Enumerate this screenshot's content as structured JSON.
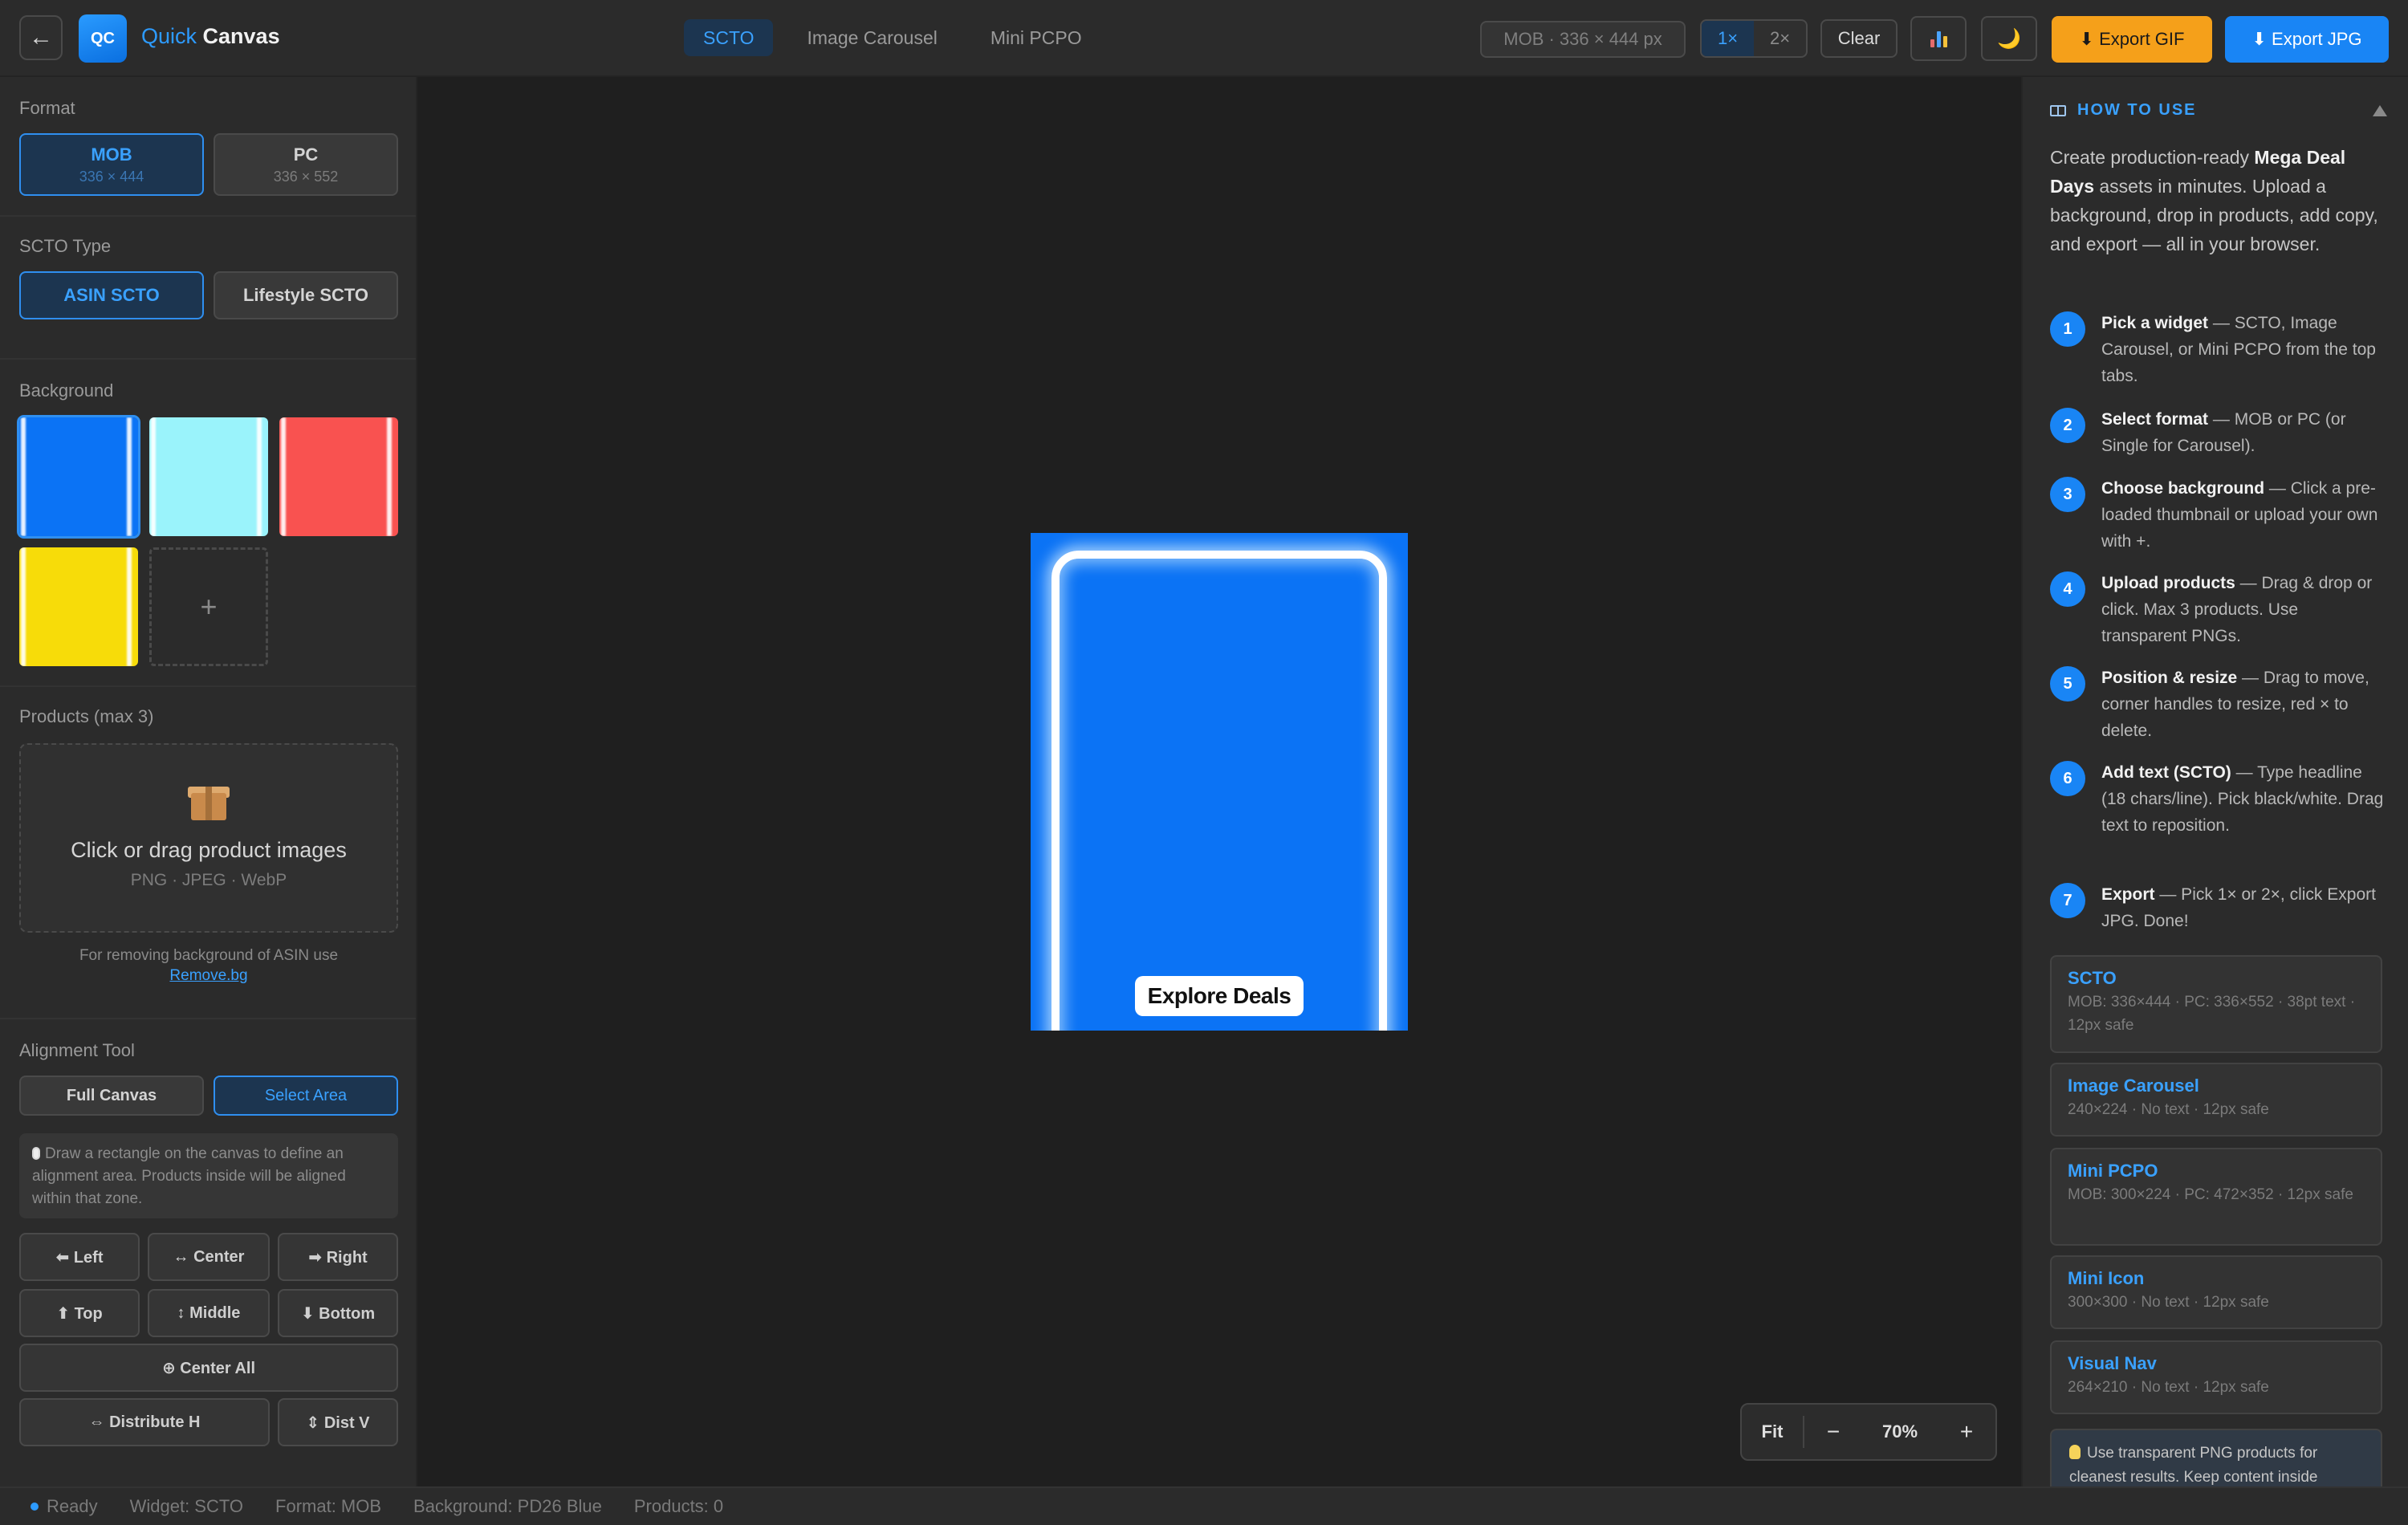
{
  "app": {
    "logo_text": "QC",
    "title_first": "Quick",
    "title_second": " Canvas"
  },
  "header": {
    "back_icon": "←",
    "tabs": [
      {
        "label": "SCTO",
        "active": true
      },
      {
        "label": "Image Carousel",
        "active": false
      },
      {
        "label": "Mini PCPO",
        "active": false
      }
    ],
    "size_readout": "MOB · 336 × 444 px",
    "scale_options": [
      {
        "label": "1×",
        "active": true
      },
      {
        "label": "2×",
        "active": false
      }
    ],
    "clear_label": "Clear",
    "stats_icon": "bar-chart-icon",
    "theme_icon": "🌙",
    "export_gif_label": "⬇ Export GIF",
    "export_jpg_label": "⬇ Export JPG",
    "colors": {
      "accent": "#1985f5",
      "gif": "#f5a01a"
    }
  },
  "sidebar": {
    "format": {
      "label": "Format",
      "options": [
        {
          "title": "MOB",
          "size": "336 × 444",
          "active": true
        },
        {
          "title": "PC",
          "size": "336 × 552",
          "active": false
        }
      ]
    },
    "scto_type": {
      "label": "SCTO Type",
      "options": [
        {
          "label": "ASIN SCTO",
          "active": true
        },
        {
          "label": "Lifestyle SCTO",
          "active": false
        }
      ]
    },
    "background": {
      "label": "Background",
      "swatches": [
        {
          "color": "#0b73f5",
          "selected": true
        },
        {
          "color": "#9af3fb",
          "selected": false
        },
        {
          "color": "#f95250",
          "selected": false
        },
        {
          "color": "#f7dc09",
          "selected": false
        }
      ],
      "add_label": "+"
    },
    "products": {
      "label": "Products (max 3)",
      "drop_title": "Click or drag product images",
      "drop_sub": "PNG · JPEG · WebP",
      "note": "For removing background of ASIN use",
      "note_link": "Remove.bg"
    },
    "alignment": {
      "label": "Alignment Tool",
      "modes": [
        {
          "label": "Full Canvas",
          "active": false
        },
        {
          "label": "Select Area",
          "active": true
        }
      ],
      "hint": "Draw a rectangle on the canvas to define an alignment area. Products inside will be aligned within that zone.",
      "buttons": {
        "left": "⬅ Left",
        "center": "↔ Center",
        "right": "➡ Right",
        "top": "⬆ Top",
        "middle": "↕ Middle",
        "bottom": "⬇ Bottom",
        "center_all": "⊕ Center All",
        "distribute_h": "⇔ Distribute H",
        "dist_v": "⇕ Dist V"
      }
    }
  },
  "canvas": {
    "cta_text": "Explore Deals",
    "zoom": {
      "fit": "Fit",
      "minus": "−",
      "value": "70%",
      "plus": "+"
    }
  },
  "how_to": {
    "title": "HOW TO USE",
    "intro_pre": "Create production-ready ",
    "intro_bold": "Mega Deal Days",
    "intro_post": " assets in minutes. Upload a background, drop in products, add copy, and export — all in your browser.",
    "steps": [
      {
        "n": "1",
        "bold": "Pick a widget",
        "text": " — SCTO, Image Carousel, or Mini PCPO from the top tabs."
      },
      {
        "n": "2",
        "bold": "Select format",
        "text": " — MOB or PC (or Single for Carousel)."
      },
      {
        "n": "3",
        "bold": "Choose background",
        "text": " — Click a pre-loaded thumbnail or upload your own with +."
      },
      {
        "n": "4",
        "bold": "Upload products",
        "text": " — Drag & drop or click. Max 3 products. Use transparent PNGs."
      },
      {
        "n": "5",
        "bold": "Position & resize",
        "text": " — Drag to move, corner handles to resize, red × to delete."
      },
      {
        "n": "6",
        "bold": "Add text (SCTO)",
        "text": " — Type headline (18 chars/line). Pick black/white. Drag text to reposition."
      },
      {
        "n": "7",
        "bold": "Export",
        "text": " — Pick 1× or 2×, click Export JPG. Done!"
      }
    ],
    "specs": [
      {
        "title": "SCTO",
        "desc": "MOB: 336×444 · PC: 336×552 · 38pt text · 12px safe"
      },
      {
        "title": "Image Carousel",
        "desc": "240×224 · No text · 12px safe"
      },
      {
        "title": "Mini PCPO",
        "desc": "MOB: 300×224 · PC: 472×352 · 12px safe"
      },
      {
        "title": "Mini Icon",
        "desc": "300×300 · No text · 12px safe"
      },
      {
        "title": "Visual Nav",
        "desc": "264×210 · No text · 12px safe"
      }
    ],
    "tip": "Use transparent PNG products for cleanest results. Keep content inside"
  },
  "status": {
    "ready": "Ready",
    "widget": "Widget: SCTO",
    "format": "Format: MOB",
    "background": "Background: PD26 Blue",
    "products": "Products: 0"
  }
}
